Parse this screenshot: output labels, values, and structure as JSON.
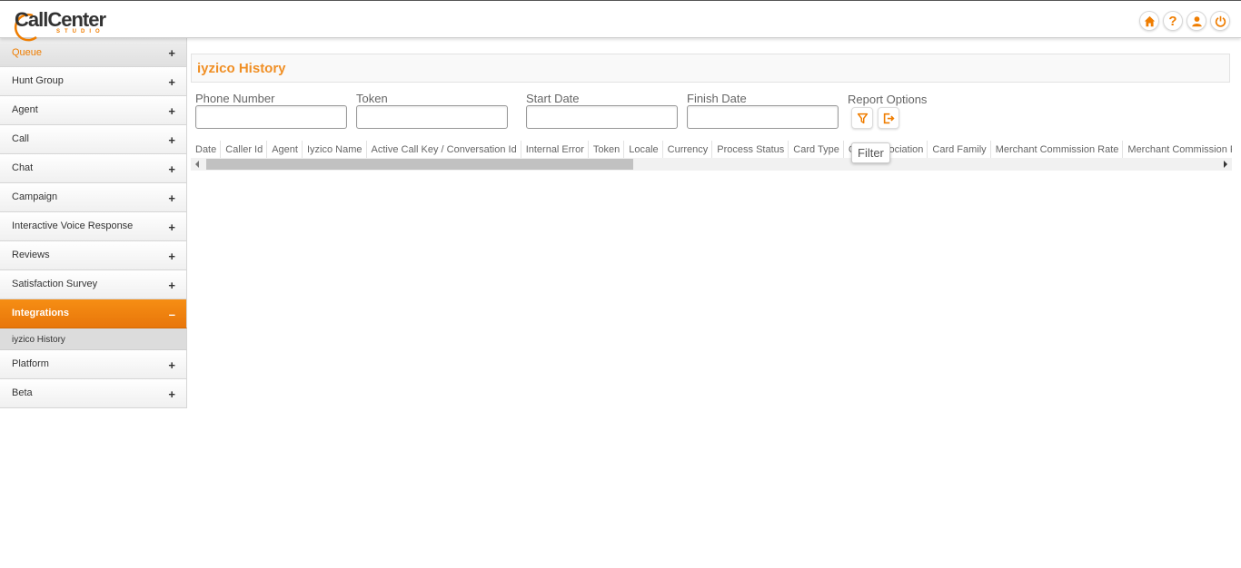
{
  "brand": {
    "name": "CallCenter",
    "subtitle": "STUDIO",
    "accent": "#ef7d00"
  },
  "top_icons": [
    "home-icon",
    "help-icon",
    "user-icon",
    "power-icon"
  ],
  "top_icon_labels": {
    "help": "?"
  },
  "sidebar": {
    "items": [
      {
        "label": "Queue",
        "sign": "+"
      },
      {
        "label": "Hunt Group",
        "sign": "+"
      },
      {
        "label": "Agent",
        "sign": "+"
      },
      {
        "label": "Call",
        "sign": "+"
      },
      {
        "label": "Chat",
        "sign": "+"
      },
      {
        "label": "Campaign",
        "sign": "+"
      },
      {
        "label": "Interactive Voice Response",
        "sign": "+"
      },
      {
        "label": "Reviews",
        "sign": "+"
      },
      {
        "label": "Satisfaction Survey",
        "sign": "+"
      },
      {
        "label": "Integrations",
        "sign": "–"
      },
      {
        "label": "Platform",
        "sign": "+"
      },
      {
        "label": "Beta",
        "sign": "+"
      }
    ],
    "sub_items": [
      {
        "label": "iyzico History"
      }
    ]
  },
  "page": {
    "title": "iyzico History"
  },
  "filters": {
    "phone_number": {
      "label": "Phone Number",
      "value": ""
    },
    "token": {
      "label": "Token",
      "value": ""
    },
    "start_date": {
      "label": "Start Date",
      "value": ""
    },
    "finish_date": {
      "label": "Finish Date",
      "value": ""
    },
    "report_options_label": "Report Options",
    "filter_tooltip": "Filter"
  },
  "grid": {
    "columns": [
      "Date",
      "Caller Id",
      "Agent",
      "Iyzico Name",
      "Active Call Key / Conversation Id",
      "Internal Error",
      "Token",
      "Locale",
      "Currency",
      "Process Status",
      "Card Type",
      "Card Association",
      "Card Family",
      "Merchant Commission Rate",
      "Merchant Commission Rate Amount"
    ]
  }
}
